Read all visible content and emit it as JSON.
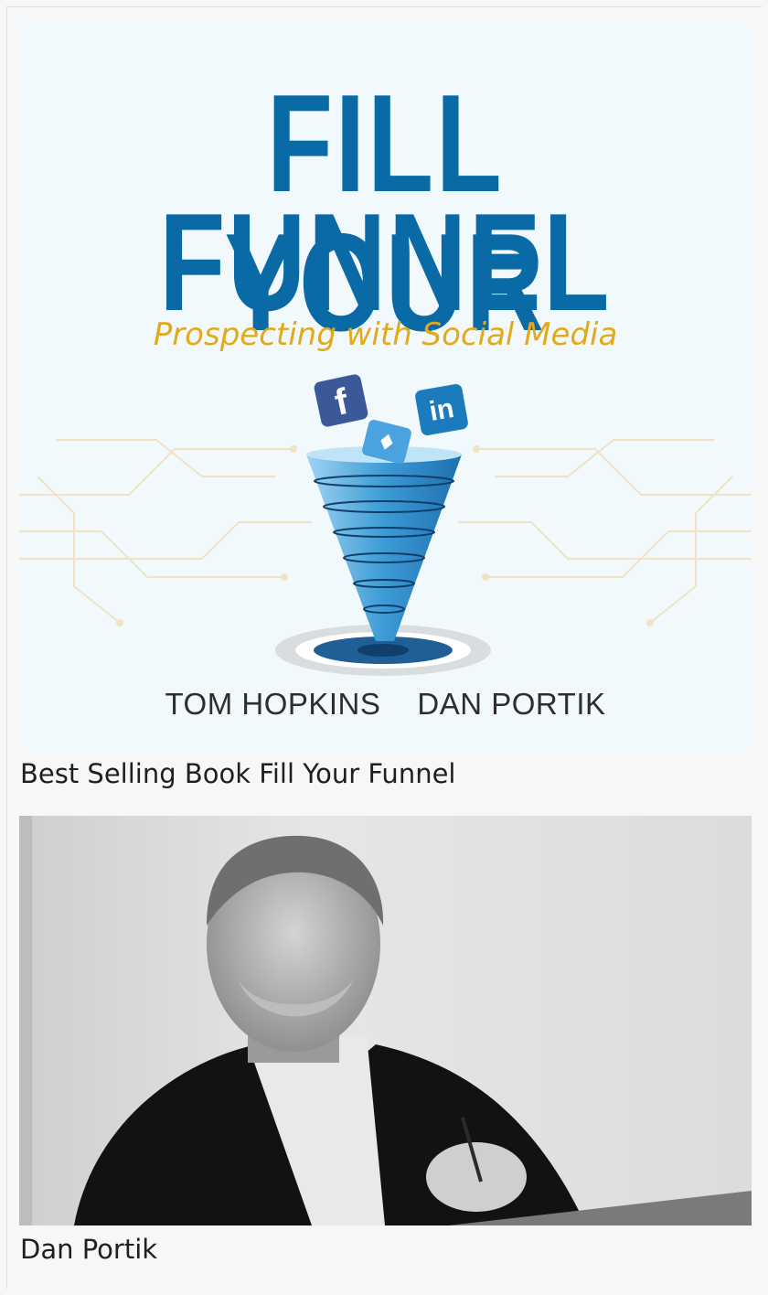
{
  "cover": {
    "title_line1": "FILL YOUR",
    "title_line2": "FUNNEL",
    "subtitle": "Prospecting with Social Media",
    "author1": "TOM HOPKINS",
    "author2": "DAN PORTIK",
    "icons": [
      "facebook-icon",
      "linkedin-icon",
      "twitter-icon",
      "funnel-graphic"
    ],
    "colors": {
      "title": "#0a6aa6",
      "subtitle": "#e3a91c",
      "background": "#f1f9fc"
    }
  },
  "captions": {
    "book": "Best Selling Book Fill Your Funnel",
    "person": "Dan Portik"
  }
}
